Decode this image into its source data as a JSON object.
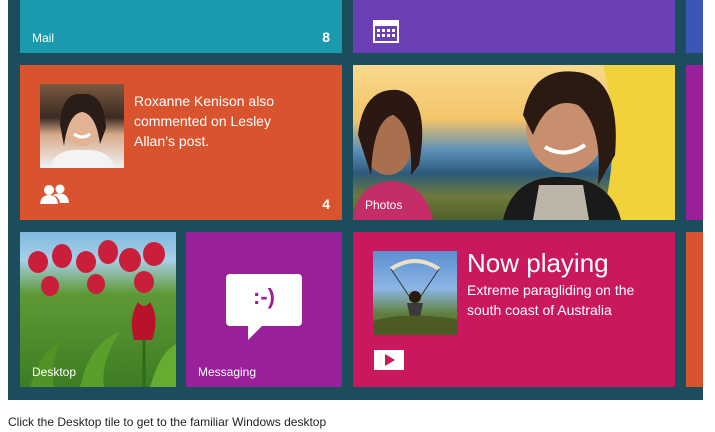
{
  "tiles": {
    "mail": {
      "label": "Mail",
      "count": "8",
      "color": "#1b9aae"
    },
    "calendar": {
      "icon": "calendar-icon",
      "color": "#6b3fb5"
    },
    "people": {
      "message": "Roxanne Kenison also commented on Lesley Allan’s post.",
      "count": "4",
      "icon": "people-icon",
      "color": "#d9542e"
    },
    "photos": {
      "label": "Photos"
    },
    "desktop": {
      "label": "Desktop"
    },
    "messaging": {
      "label": "Messaging",
      "emoticon": ":-)",
      "icon": "speech-bubble-icon",
      "color": "#9a1f9a"
    },
    "now_playing": {
      "title": "Now playing",
      "subtitle": "Extreme paragliding on the south coast of Australia",
      "icon": "play-icon",
      "color": "#c9185e"
    }
  },
  "caption": "Click the Desktop tile to get to the familiar Windows desktop"
}
